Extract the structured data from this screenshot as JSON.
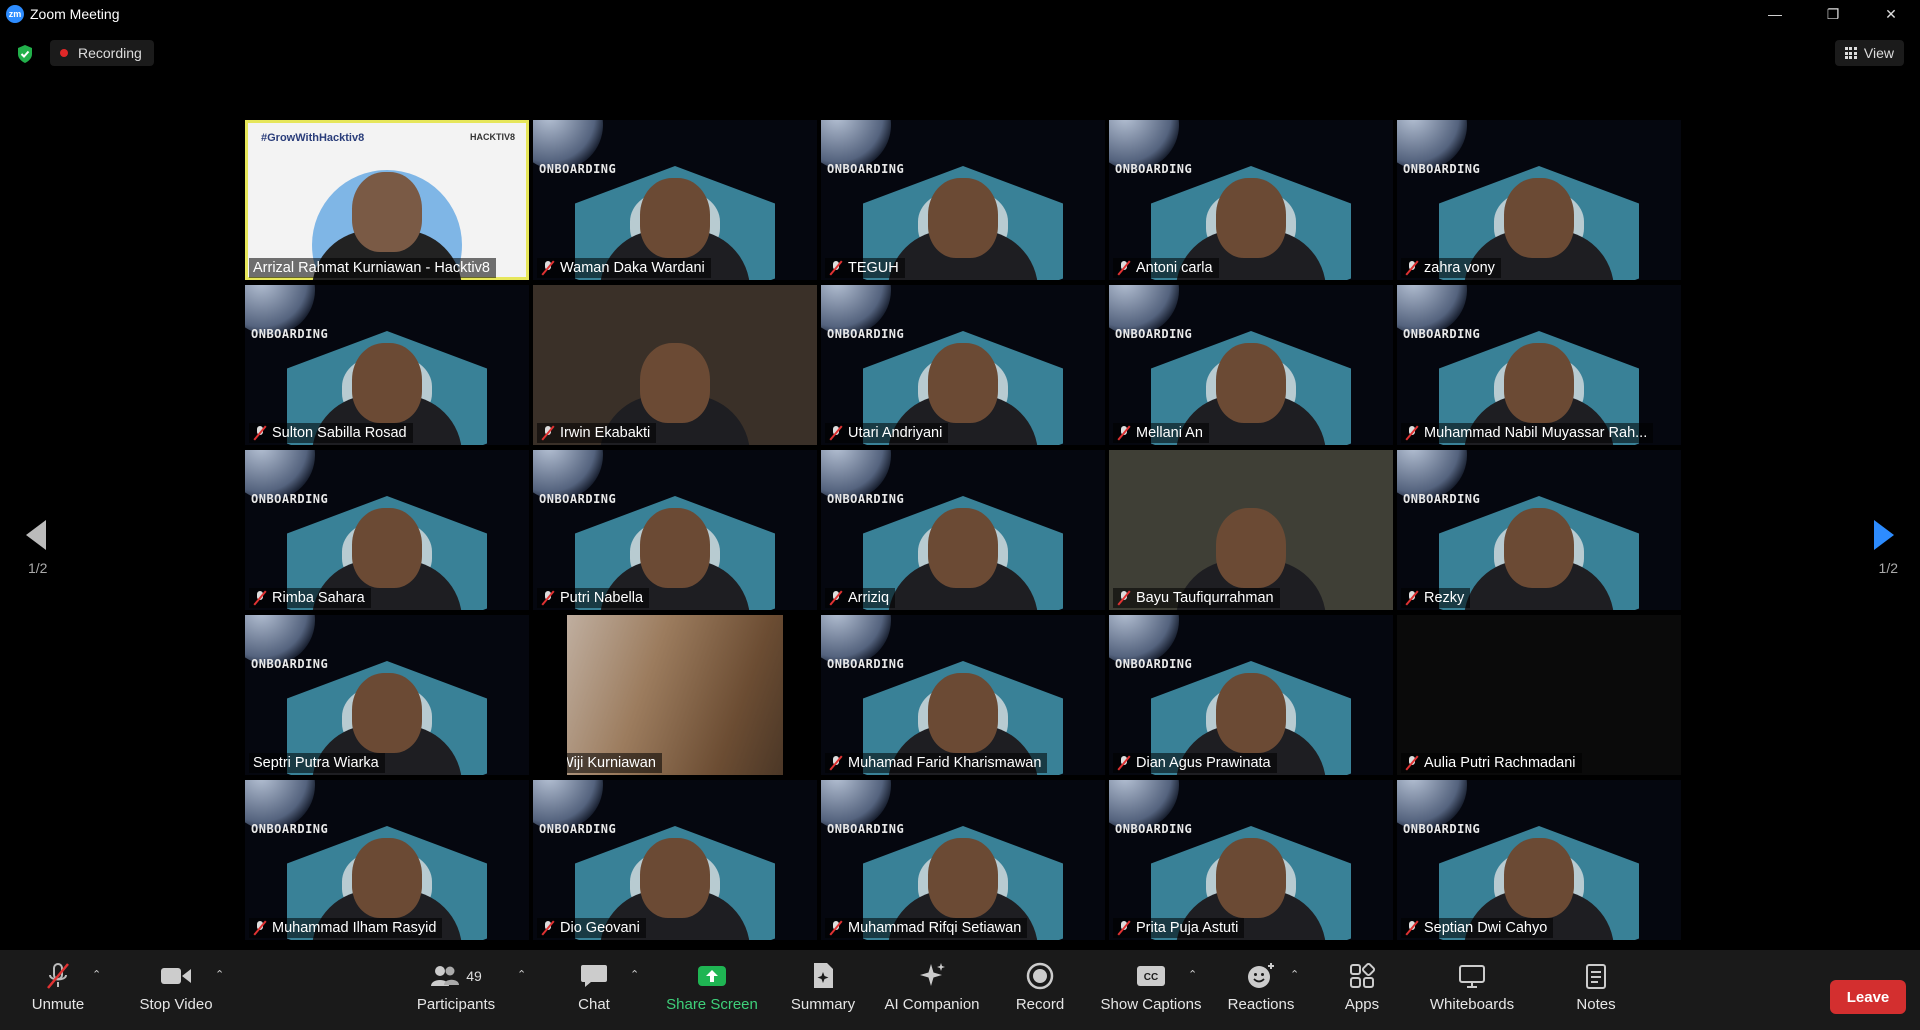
{
  "window": {
    "title": "Zoom Meeting",
    "logo_text": "zm",
    "minimize": "—",
    "maximize": "❐",
    "close": "✕"
  },
  "topbar": {
    "recording_label": "Recording",
    "view_label": "View"
  },
  "pagination": {
    "left_page": "1/2",
    "right_page": "1/2"
  },
  "slide": {
    "heading": "ONBOARDING",
    "host_heading": "#GrowWithHacktiv8",
    "host_logo": "HACKTIV8"
  },
  "participants": [
    {
      "name": "Arrizal Rahmat Kurniawan - Hacktiv8",
      "muted": false,
      "kind": "host"
    },
    {
      "name": "Waman Daka Wardani",
      "muted": true,
      "kind": "slide"
    },
    {
      "name": "TEGUH",
      "muted": true,
      "kind": "slide"
    },
    {
      "name": "Antoni carla",
      "muted": true,
      "kind": "slide"
    },
    {
      "name": "zahra vony",
      "muted": true,
      "kind": "slide"
    },
    {
      "name": "Sulton Sabilla Rosad",
      "muted": true,
      "kind": "slide"
    },
    {
      "name": "Irwin Ekabakti",
      "muted": true,
      "kind": "room"
    },
    {
      "name": "Utari Andriyani",
      "muted": true,
      "kind": "slide"
    },
    {
      "name": "Mellani An",
      "muted": true,
      "kind": "slide"
    },
    {
      "name": "Muhammad Nabil Muyassar Rah...",
      "muted": true,
      "kind": "slide"
    },
    {
      "name": "Rimba Sahara",
      "muted": true,
      "kind": "slide"
    },
    {
      "name": "Putri Nabella",
      "muted": true,
      "kind": "slide"
    },
    {
      "name": "Arriziq",
      "muted": true,
      "kind": "slide"
    },
    {
      "name": "Bayu Taufiqurrahman",
      "muted": true,
      "kind": "dim"
    },
    {
      "name": "Rezky",
      "muted": true,
      "kind": "slide"
    },
    {
      "name": "Septri Putra Wiarka",
      "muted": false,
      "kind": "slide"
    },
    {
      "name": "Wiji Kurniawan",
      "muted": true,
      "kind": "blur"
    },
    {
      "name": "Muhamad Farid Kharismawan",
      "muted": true,
      "kind": "slide"
    },
    {
      "name": "Dian Agus Prawinata",
      "muted": true,
      "kind": "slide"
    },
    {
      "name": "Aulia Putri Rachmadani",
      "muted": true,
      "kind": "plain"
    },
    {
      "name": "Muhammad Ilham Rasyid",
      "muted": true,
      "kind": "slide"
    },
    {
      "name": "Dio Geovani",
      "muted": true,
      "kind": "slide"
    },
    {
      "name": "Muhammad Rifqi Setiawan",
      "muted": true,
      "kind": "slide"
    },
    {
      "name": "Prita Puja Astuti",
      "muted": true,
      "kind": "slide"
    },
    {
      "name": "Septian Dwi Cahyo",
      "muted": true,
      "kind": "slide"
    }
  ],
  "toolbar": {
    "unmute": "Unmute",
    "stop_video": "Stop Video",
    "participants": "Participants",
    "participants_count": "49",
    "chat": "Chat",
    "share_screen": "Share Screen",
    "summary": "Summary",
    "ai_companion": "AI Companion",
    "record": "Record",
    "show_captions": "Show Captions",
    "cc": "CC",
    "reactions": "Reactions",
    "apps": "Apps",
    "whiteboards": "Whiteboards",
    "notes": "Notes",
    "leave": "Leave"
  },
  "colors": {
    "accent_green": "#3ed07a",
    "leave_red": "#d32f2f",
    "active_speaker": "#e6e65a",
    "zoom_blue": "#2d8cff"
  }
}
